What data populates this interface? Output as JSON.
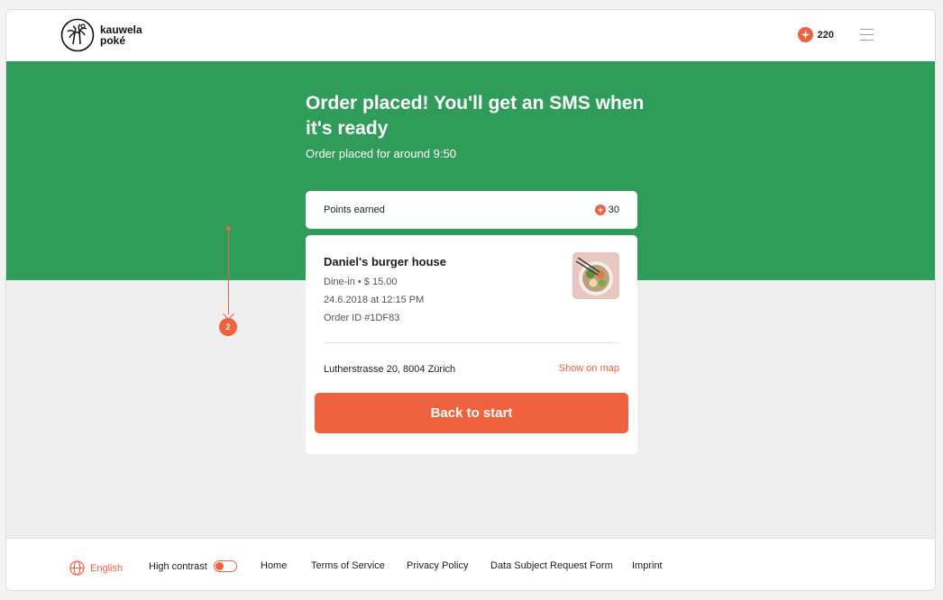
{
  "header": {
    "logo_line1": "kauwela",
    "logo_line2": "poké",
    "points_balance": "220"
  },
  "hero": {
    "title": "Order placed! You'll get an SMS when it's ready",
    "subtitle": "Order placed for around 9:50"
  },
  "points_card": {
    "label": "Points earned",
    "value": "30"
  },
  "order": {
    "restaurant": "Daniel's burger house",
    "type_price": "Dine-in • $ 15.00",
    "datetime": "24.6.2018 at 12:15 PM",
    "order_id": "Order ID #1DF83",
    "address": "Lutherstrasse 20, 8004 Zürich",
    "map_link": "Show on map",
    "back_button": "Back to start"
  },
  "annotation": {
    "marker": "2"
  },
  "footer": {
    "language": "English",
    "high_contrast": "High contrast",
    "home": "Home",
    "terms": "Terms of Service",
    "privacy": "Privacy Policy",
    "dsr_form": "Data Subject Request Form",
    "imprint": "Imprint"
  },
  "colors": {
    "brand_green": "#2f9c5a",
    "accent_orange": "#ef6240"
  },
  "icons": [
    "palm-logo-icon",
    "star-icon",
    "menu-icon",
    "globe-icon",
    "toggle-switch"
  ]
}
